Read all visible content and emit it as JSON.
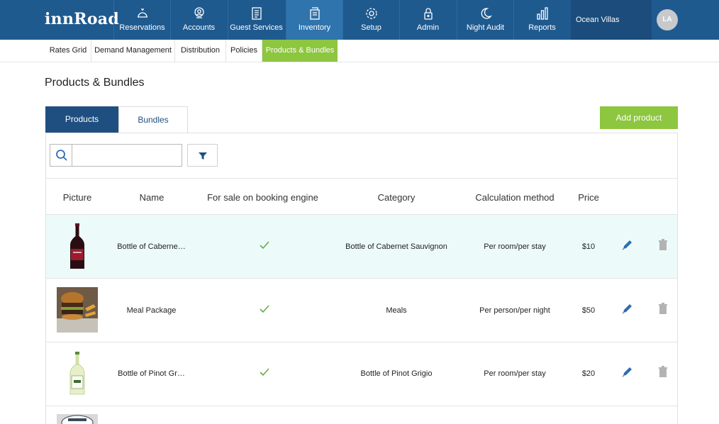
{
  "app": {
    "logo": "innRoad",
    "property": "Ocean Villas",
    "user_initials": "LA"
  },
  "nav": [
    {
      "label": "Reservations",
      "icon": "bell-icon",
      "active": false
    },
    {
      "label": "Accounts",
      "icon": "accounts-icon",
      "active": false
    },
    {
      "label": "Guest Services",
      "icon": "clipboard-icon",
      "active": false
    },
    {
      "label": "Inventory",
      "icon": "inventory-icon",
      "active": true
    },
    {
      "label": "Setup",
      "icon": "gear-icon",
      "active": false
    },
    {
      "label": "Admin",
      "icon": "lock-icon",
      "active": false
    },
    {
      "label": "Night Audit",
      "icon": "moon-icon",
      "active": false
    },
    {
      "label": "Reports",
      "icon": "bar-chart-icon",
      "active": false
    }
  ],
  "subnav": [
    {
      "label": "Rates Grid",
      "active": false
    },
    {
      "label": "Demand Management",
      "active": false
    },
    {
      "label": "Distribution",
      "active": false
    },
    {
      "label": "Policies",
      "active": false
    },
    {
      "label": "Products & Bundles",
      "active": true
    }
  ],
  "page": {
    "title": "Products & Bundles",
    "tabs": {
      "products": "Products",
      "bundles": "Bundles"
    },
    "add_button": "Add product",
    "search_placeholder": ""
  },
  "table": {
    "headers": {
      "picture": "Picture",
      "name": "Name",
      "sale": "For sale on booking engine",
      "category": "Category",
      "calc": "Calculation method",
      "price": "Price"
    },
    "rows": [
      {
        "name": "Bottle of Caberne…",
        "for_sale": true,
        "category": "Bottle of Cabernet Sauvignon",
        "calc": "Per room/per stay",
        "price": "$10",
        "image": "red-wine-bottle",
        "highlighted": true
      },
      {
        "name": "Meal Package",
        "for_sale": true,
        "category": "Meals",
        "calc": "Per person/per night",
        "price": "$50",
        "image": "burger-meal",
        "highlighted": false
      },
      {
        "name": "Bottle of Pinot Gr…",
        "for_sale": true,
        "category": "Bottle of Pinot Grigio",
        "calc": "Per room/per stay",
        "price": "$20",
        "image": "white-wine-bottle",
        "highlighted": false
      }
    ]
  },
  "colors": {
    "nav_bg": "#1f5a8f",
    "nav_active": "#2f74ad",
    "accent_green": "#8dc63f",
    "tab_active": "#1f4f80",
    "row_highlight": "#ecfbfa",
    "check": "#6aa84f",
    "edit_icon": "#2f6db5",
    "delete_icon": "#b3b3b3"
  }
}
